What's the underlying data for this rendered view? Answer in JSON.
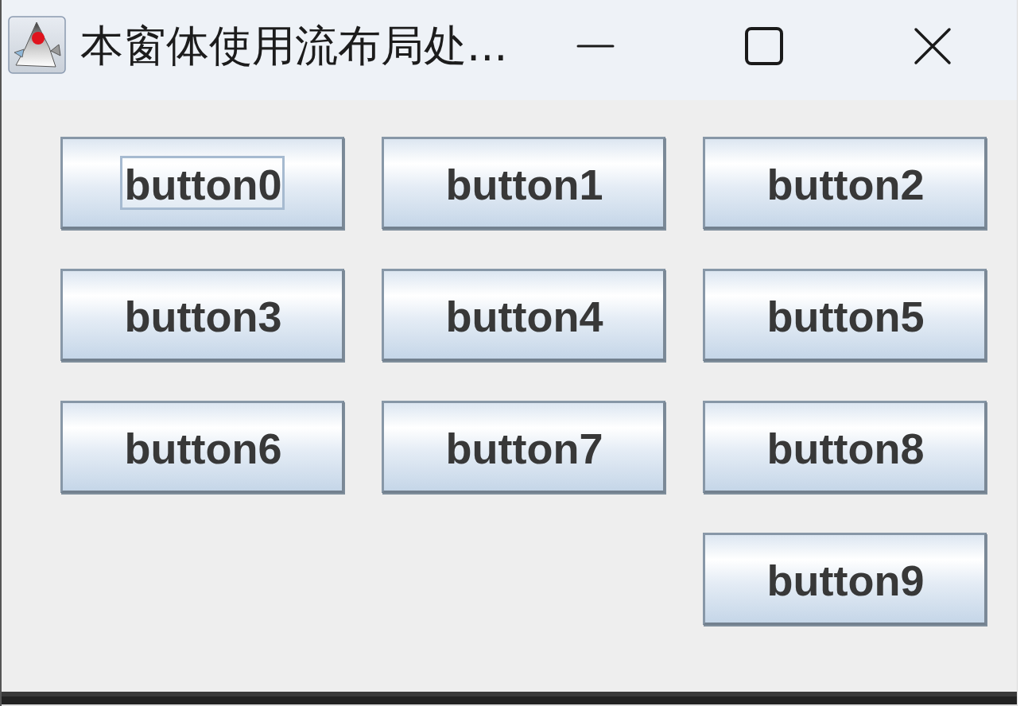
{
  "window": {
    "title": "本窗体使用流布局处..."
  },
  "buttons": [
    {
      "label": "button0",
      "focused": true
    },
    {
      "label": "button1",
      "focused": false
    },
    {
      "label": "button2",
      "focused": false
    },
    {
      "label": "button3",
      "focused": false
    },
    {
      "label": "button4",
      "focused": false
    },
    {
      "label": "button5",
      "focused": false
    },
    {
      "label": "button6",
      "focused": false
    },
    {
      "label": "button7",
      "focused": false
    },
    {
      "label": "button8",
      "focused": false
    },
    {
      "label": "button9",
      "focused": false
    }
  ]
}
